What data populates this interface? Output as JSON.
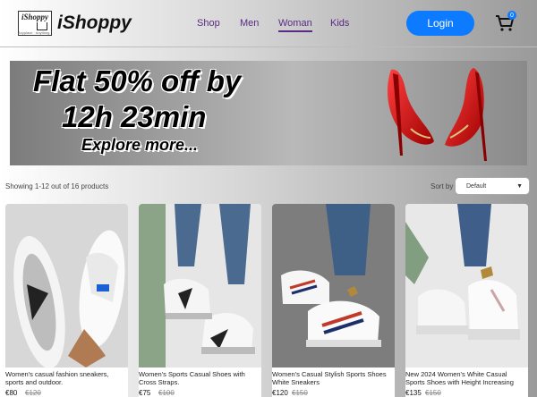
{
  "header": {
    "logo_small": "iShoppy",
    "logo_tagline": "Anyplace · Anything",
    "brand": "iShoppy",
    "nav": [
      "Shop",
      "Men",
      "Woman",
      "Kids"
    ],
    "active_nav": "Woman",
    "login": "Login",
    "cart_count": "0",
    "cart_icon": "shopping-cart-icon",
    "accent": "#0d7bff",
    "nav_color": "#5b2a86"
  },
  "banner": {
    "line1": "Flat 50% off by",
    "line2": "12h 23min",
    "line3": "Explore more..."
  },
  "toolbar": {
    "showing": "Showing 1-12 out of 16 products",
    "sort_label": "Sort by",
    "sort_value": "Default"
  },
  "products": [
    {
      "title": "Women's casual fashion sneakers, sports and outdoor.",
      "price": "€80",
      "old_price": "€120"
    },
    {
      "title": "Women's Sports Casual Shoes with Cross Straps.",
      "price": "€75",
      "old_price": "€100"
    },
    {
      "title": "Women's Casual Stylish Sports Shoes White Sneakers",
      "price": "€120",
      "old_price": "€150"
    },
    {
      "title": "New 2024 Women's White Casual Sports Shoes with Height Increasing",
      "price": "€135",
      "old_price": "€150"
    }
  ]
}
